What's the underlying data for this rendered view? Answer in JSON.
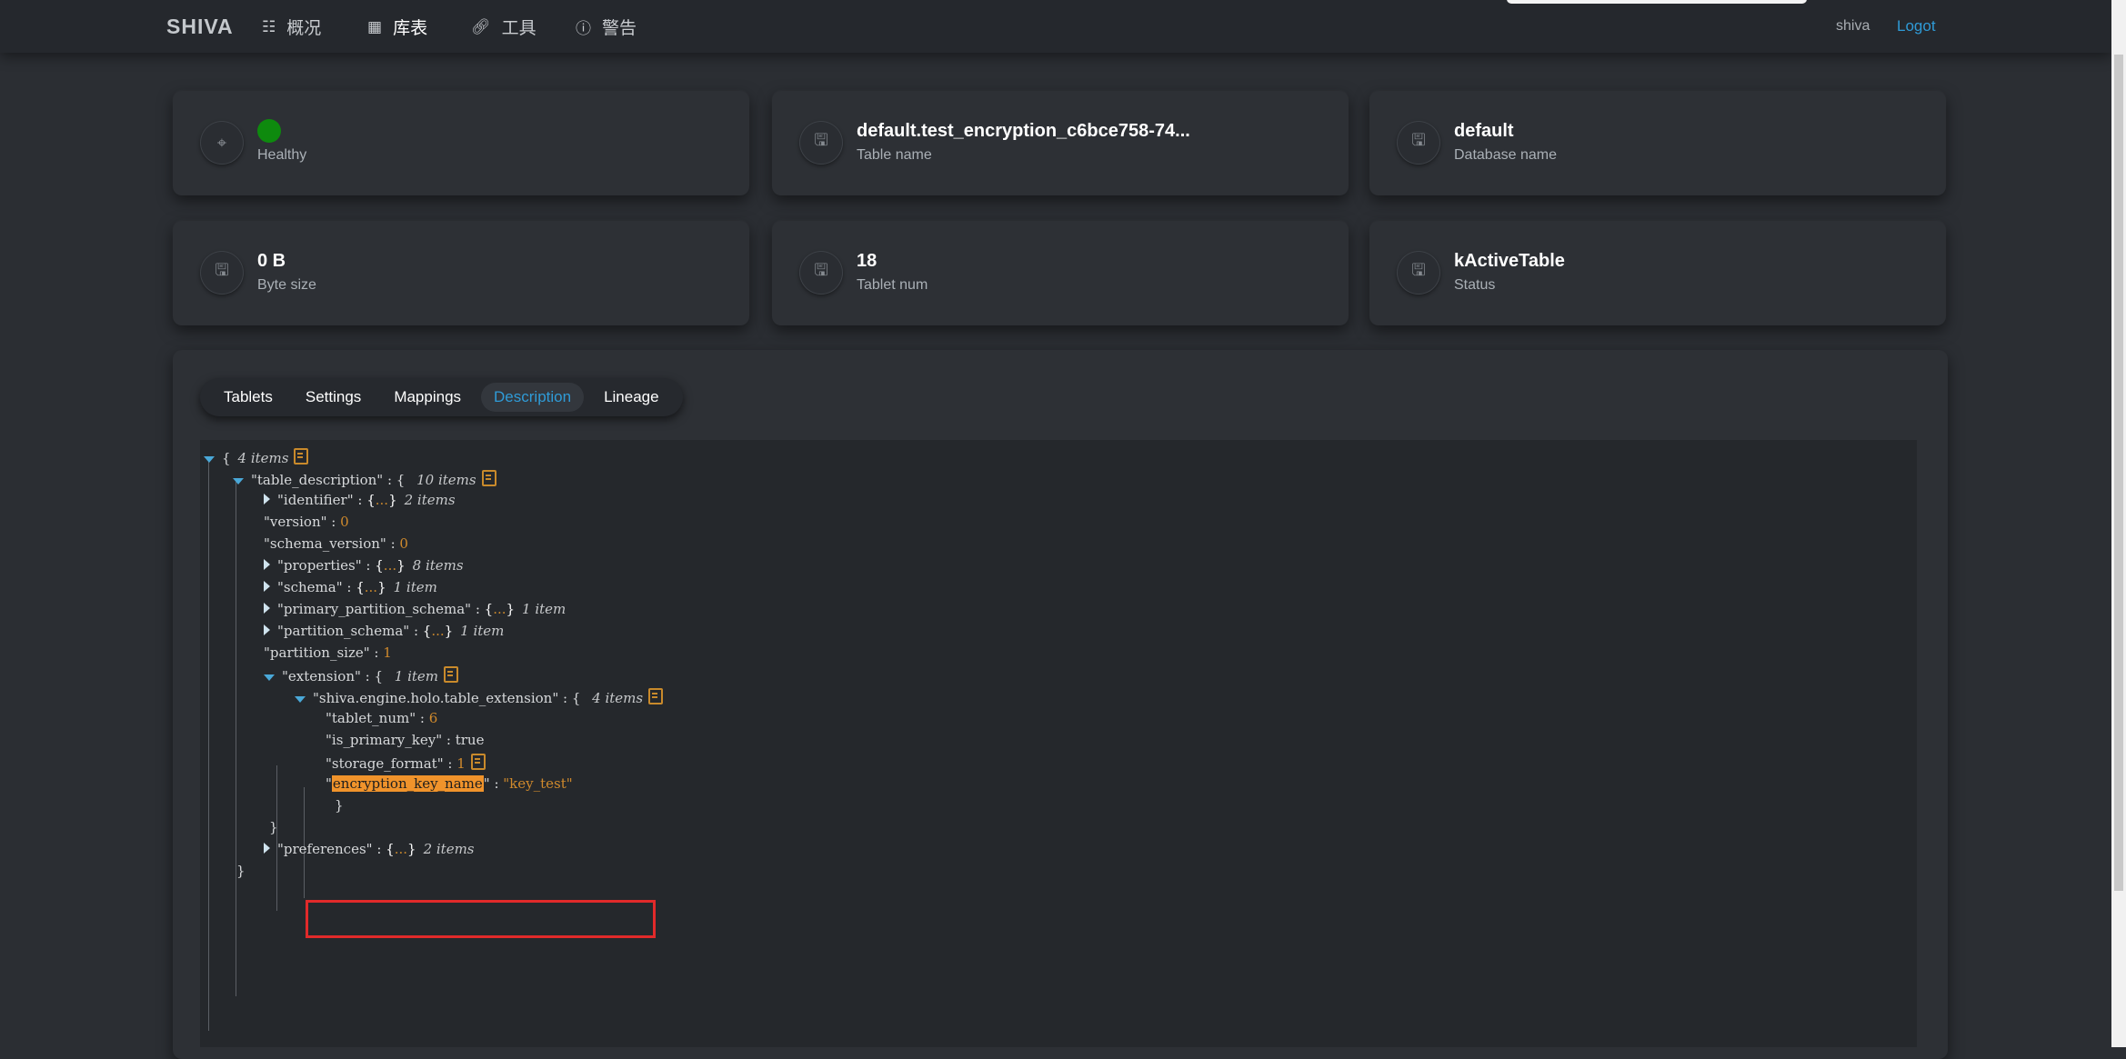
{
  "nav": {
    "brand": "SHIVA",
    "items": [
      {
        "label": "概况",
        "icon": "dashboard-icon"
      },
      {
        "label": "库表",
        "icon": "grid-icon"
      },
      {
        "label": "工具",
        "icon": "link-icon"
      },
      {
        "label": "警告",
        "icon": "info-icon"
      }
    ],
    "user": "shiva",
    "logout": "Logot"
  },
  "cards": {
    "health": {
      "value": "",
      "label": "Healthy",
      "status_color": "#0e8a0e"
    },
    "table_name": {
      "value": "default.test_encryption_c6bce758-74...",
      "label": "Table name"
    },
    "database_name": {
      "value": "default",
      "label": "Database name"
    },
    "byte_size": {
      "value": "0 B",
      "label": "Byte size"
    },
    "tablet_num": {
      "value": "18",
      "label": "Tablet num"
    },
    "status": {
      "value": "kActiveTable",
      "label": "Status"
    }
  },
  "tabs": {
    "items": [
      "Tablets",
      "Settings",
      "Mappings",
      "Description",
      "Lineage"
    ],
    "active": "Description"
  },
  "json": {
    "root_count": "4 items",
    "table_description_key": "\"table_description\"",
    "table_description_count": "10 items",
    "identifier_key": "\"identifier\"",
    "identifier_count": "2 items",
    "version_key": "\"version\"",
    "version_value": "0",
    "schema_version_key": "\"schema_version\"",
    "schema_version_value": "0",
    "properties_key": "\"properties\"",
    "properties_count": "8 items",
    "schema_key": "\"schema\"",
    "schema_count": "1 item",
    "primary_partition_schema_key": "\"primary_partition_schema\"",
    "primary_partition_schema_count": "1 item",
    "partition_schema_key": "\"partition_schema\"",
    "partition_schema_count": "1 item",
    "partition_size_key": "\"partition_size\"",
    "partition_size_value": "1",
    "extension_key": "\"extension\"",
    "extension_count": "1 item",
    "table_extension_key": "\"shiva.engine.holo.table_extension\"",
    "table_extension_count": "4 items",
    "tablet_num_key": "\"tablet_num\"",
    "tablet_num_value": "6",
    "is_primary_key_key": "\"is_primary_key\"",
    "is_primary_key_value": "true",
    "storage_format_key": "\"storage_format\"",
    "storage_format_value": "1",
    "encryption_key_name_key": "encryption_key_name",
    "encryption_key_name_value": "\"key_test\"",
    "preferences_key": "\"preferences\"",
    "preferences_count": "2 items"
  }
}
